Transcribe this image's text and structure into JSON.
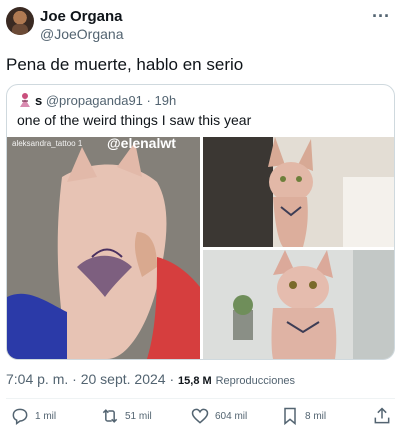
{
  "author": {
    "name": "Joe Organa",
    "handle": "@JoeOrgana"
  },
  "more_icon": "more-dots-icon",
  "tweet_text": "Pena de muerte, hablo en serio",
  "quoted": {
    "user_initial": "s",
    "handle": "@propaganda91",
    "time": "19h",
    "text": "one of the weird things I saw this year",
    "media": {
      "watermark_small": "aleksandra_tattoo",
      "watermark_small_suffix": "1",
      "watermark_big": "@elenalwt"
    }
  },
  "meta": {
    "time": "7:04 p. m.",
    "date": "20 sept. 2024",
    "views_count": "15,8 M",
    "views_label": "Reproducciones"
  },
  "actions": {
    "replies": "1 mil",
    "retweets": "51 mil",
    "likes": "604 mil",
    "bookmarks": "8 mil"
  }
}
